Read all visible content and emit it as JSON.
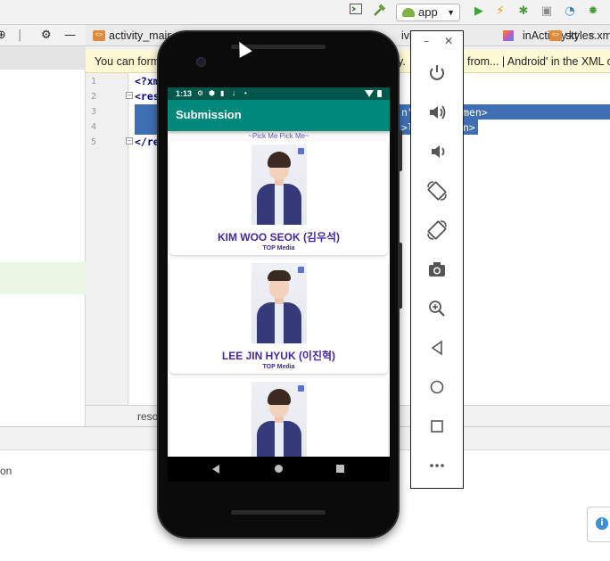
{
  "ide": {
    "run_config": "app",
    "tabs": [
      {
        "label": "activity_main",
        "type": "xml"
      },
      {
        "label": "ivity.kt",
        "type": "kt"
      },
      {
        "label": "inActivity.kt",
        "type": "kt"
      },
      {
        "label": "styles.xml",
        "type": "xml"
      }
    ],
    "banner_left": "You can form",
    "banner_mid": "y.",
    "banner_right": "from... | Android' in the XML c",
    "line_numbers": [
      "1",
      "2",
      "3",
      "4",
      "5"
    ],
    "code": {
      "line1_fragment": "<?xm",
      "line2_fragment": "<res",
      "line5_fragment": "</re",
      "sel_line3_a": "n\"",
      "sel_line3_b": "men>",
      "sel_line4_a": ">l",
      "sel_line4_b": "n>"
    },
    "editor_footer": "reso",
    "bottom_panel_text": "on"
  },
  "phone": {
    "status_time": "1:13",
    "app_title": "Submission",
    "subtitle": "~Pick Me Pick Me~",
    "trainees": [
      {
        "name": "KIM WOO SEOK (김우석)",
        "company": "TOP Media"
      },
      {
        "name": "LEE JIN HYUK (이진혁)",
        "company": "TOP Media"
      },
      {
        "name": "",
        "company": ""
      }
    ]
  },
  "emulator_toolbar": {
    "buttons": [
      "power-icon",
      "volume-up-icon",
      "volume-down-icon",
      "rotate-left-icon",
      "rotate-right-icon",
      "camera-icon",
      "zoom-icon",
      "back-icon",
      "home-icon",
      "overview-icon",
      "more-icon"
    ]
  },
  "colors": {
    "app_bar": "#00897b",
    "status_bar": "#00574b",
    "name_text": "#4527a0",
    "selection": "#3e6fb5"
  }
}
